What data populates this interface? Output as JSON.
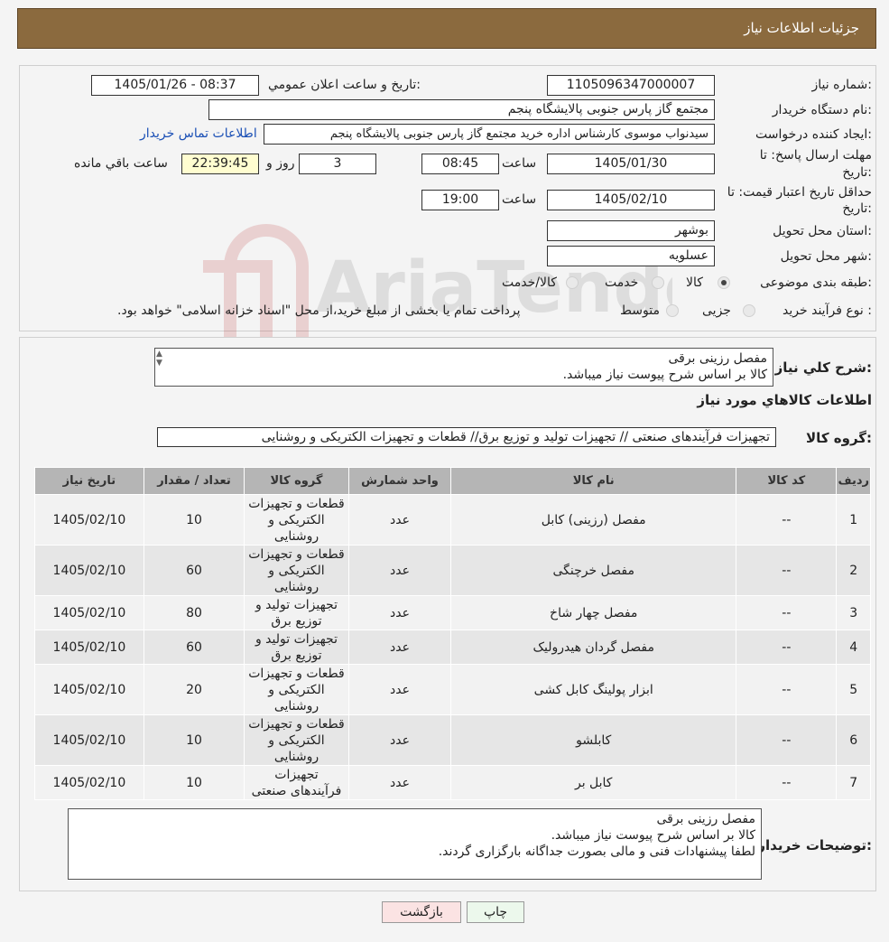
{
  "header": {
    "title": "جزئیات اطلاعات نیاز"
  },
  "info": {
    "need_no_label": "شماره نیاز:",
    "need_no": "1105096347000007",
    "announce_label": "تاریخ و ساعت اعلان عمومي:",
    "announce_value": "1405/01/26 - 08:37",
    "buyer_label": "نام دستگاه خریدار:",
    "buyer_value": "مجتمع گاز پارس جنوبی  پالایشگاه پنجم",
    "creator_label": "ایجاد کننده درخواست:",
    "creator_value": "سیدنواب موسوی کارشناس اداره خرید مجتمع گاز پارس جنوبی  پالایشگاه پنجم",
    "contact_link": "اطلاعات تماس خریدار",
    "deadline_label_1": "مهلت ارسال پاسخ: تا",
    "deadline_label_2": "تاریخ:",
    "deadline_date": "1405/01/30",
    "time_label": "ساعت",
    "deadline_time": "08:45",
    "days_value": "3",
    "days_label": "روز و",
    "remaining_time": "22:39:45",
    "remaining_label": "ساعت باقي مانده",
    "validity_label_1": "حداقل تاریخ اعتبار قیمت: تا",
    "validity_label_2": "تاریخ:",
    "validity_date": "1405/02/10",
    "validity_time": "19:00",
    "province_label": "استان محل تحویل:",
    "province_value": "بوشهر",
    "city_label": "شهر محل تحویل:",
    "city_value": "عسلویه",
    "category_label": "طبقه بندی موضوعی:",
    "category_options": [
      "کالا",
      "خدمت",
      "کالا/خدمت"
    ],
    "category_selected": "کالا",
    "process_label": "نوع فرآیند خرید :",
    "process_options": [
      "جزیی",
      "متوسط"
    ],
    "process_note": "پرداخت تمام یا بخشی از مبلغ خرید،از محل \"اسناد خزانه اسلامی\" خواهد بود."
  },
  "watermark": {
    "text": "AriaTender.neT"
  },
  "summary": {
    "label": "شرح کلي نیاز:",
    "lines": [
      "مفصل رزینی برقی",
      "کالا بر اساس شرح پیوست نیاز میباشد."
    ]
  },
  "goods_info_title": "اطلاعات کالاهاي مورد نیاز",
  "goods_group": {
    "label": "گروه کالا:",
    "value": "تجهیزات فرآیندهای صنعتی // تجهیزات تولید و توزیع برق// قطعات و تجهیزات الکتریکی و روشنایی"
  },
  "table": {
    "headers": [
      "ردیف",
      "کد کالا",
      "نام کالا",
      "واحد شمارش",
      "گروه کالا",
      "تعداد / مقدار",
      "تاریخ نیاز"
    ],
    "rows": [
      [
        "1",
        "--",
        "مفصل (رزینی) کابل",
        "عدد",
        "قطعات و تجهیزات الکتریکی و روشنایی",
        "10",
        "1405/02/10"
      ],
      [
        "2",
        "--",
        "مفصل خرچنگی",
        "عدد",
        "قطعات و تجهیزات الکتریکی و روشنایی",
        "60",
        "1405/02/10"
      ],
      [
        "3",
        "--",
        "مفصل چهار شاخ",
        "عدد",
        "تجهیزات تولید و توزیع برق",
        "80",
        "1405/02/10"
      ],
      [
        "4",
        "--",
        "مفصل گردان هیدرولیک",
        "عدد",
        "تجهیزات تولید و توزیع برق",
        "60",
        "1405/02/10"
      ],
      [
        "5",
        "--",
        "ابزار پولینگ کابل کشی",
        "عدد",
        "قطعات و تجهیزات الکتریکی و روشنایی",
        "20",
        "1405/02/10"
      ],
      [
        "6",
        "--",
        "کابلشو",
        "عدد",
        "قطعات و تجهیزات الکتریکی و روشنایی",
        "10",
        "1405/02/10"
      ],
      [
        "7",
        "--",
        "کابل بر",
        "عدد",
        "تجهیزات فرآیندهای صنعتی",
        "10",
        "1405/02/10"
      ]
    ]
  },
  "buyer_notes": {
    "label": "توضیحات خریدار:",
    "lines": [
      "مفصل رزینی برقی",
      "کالا بر اساس شرح پیوست نیاز میباشد.",
      "لطفا پیشنهادات فنی و مالی بصورت جداگانه بارگزاری گردند."
    ]
  },
  "buttons": {
    "print": "چاپ",
    "back": "بازگشت"
  }
}
